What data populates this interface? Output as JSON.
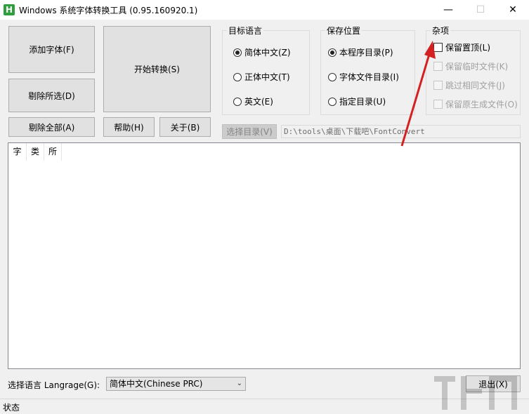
{
  "window": {
    "title": "Windows 系统字体转换工具 (0.95.160920.1)",
    "app_icon_letter": "H",
    "minimize_glyph": "—",
    "maximize_glyph": "☐",
    "close_glyph": "✕"
  },
  "buttons": {
    "add_font": "添加字体(F)",
    "start_convert": "开始转换(S)",
    "remove_selected": "剔除所选(D)",
    "remove_all": "剔除全部(A)",
    "help": "帮助(H)",
    "about": "关于(B)",
    "choose_dir": "选择目录(V)",
    "exit": "退出(X)"
  },
  "target_language": {
    "title": "目标语言",
    "options": [
      {
        "label": "简体中文(Z)",
        "selected": true
      },
      {
        "label": "正体中文(T)",
        "selected": false
      },
      {
        "label": "英文(E)",
        "selected": false
      }
    ]
  },
  "save_location": {
    "title": "保存位置",
    "options": [
      {
        "label": "本程序目录(P)",
        "selected": true
      },
      {
        "label": "字体文件目录(I)",
        "selected": false
      },
      {
        "label": "指定目录(U)",
        "selected": false
      }
    ]
  },
  "misc": {
    "title": "杂项",
    "options": [
      {
        "label": "保留置顶(L)",
        "checked": false,
        "enabled": true
      },
      {
        "label": "保留临时文件(K)",
        "checked": false,
        "enabled": false
      },
      {
        "label": "跳过相同文件(J)",
        "checked": false,
        "enabled": false
      },
      {
        "label": "保留原生成文件(O)",
        "checked": false,
        "enabled": false
      }
    ]
  },
  "output_path": "D:\\tools\\桌面\\下载吧\\FontConvert",
  "file_list": {
    "columns": [
      "字",
      "类",
      "所"
    ]
  },
  "language_select": {
    "label": "选择语言 Langrage(G):",
    "value": "简体中文(Chinese PRC)"
  },
  "status": "状态",
  "colors": {
    "annotation_arrow": "#d42020",
    "app_icon": "#2e9e3e"
  }
}
